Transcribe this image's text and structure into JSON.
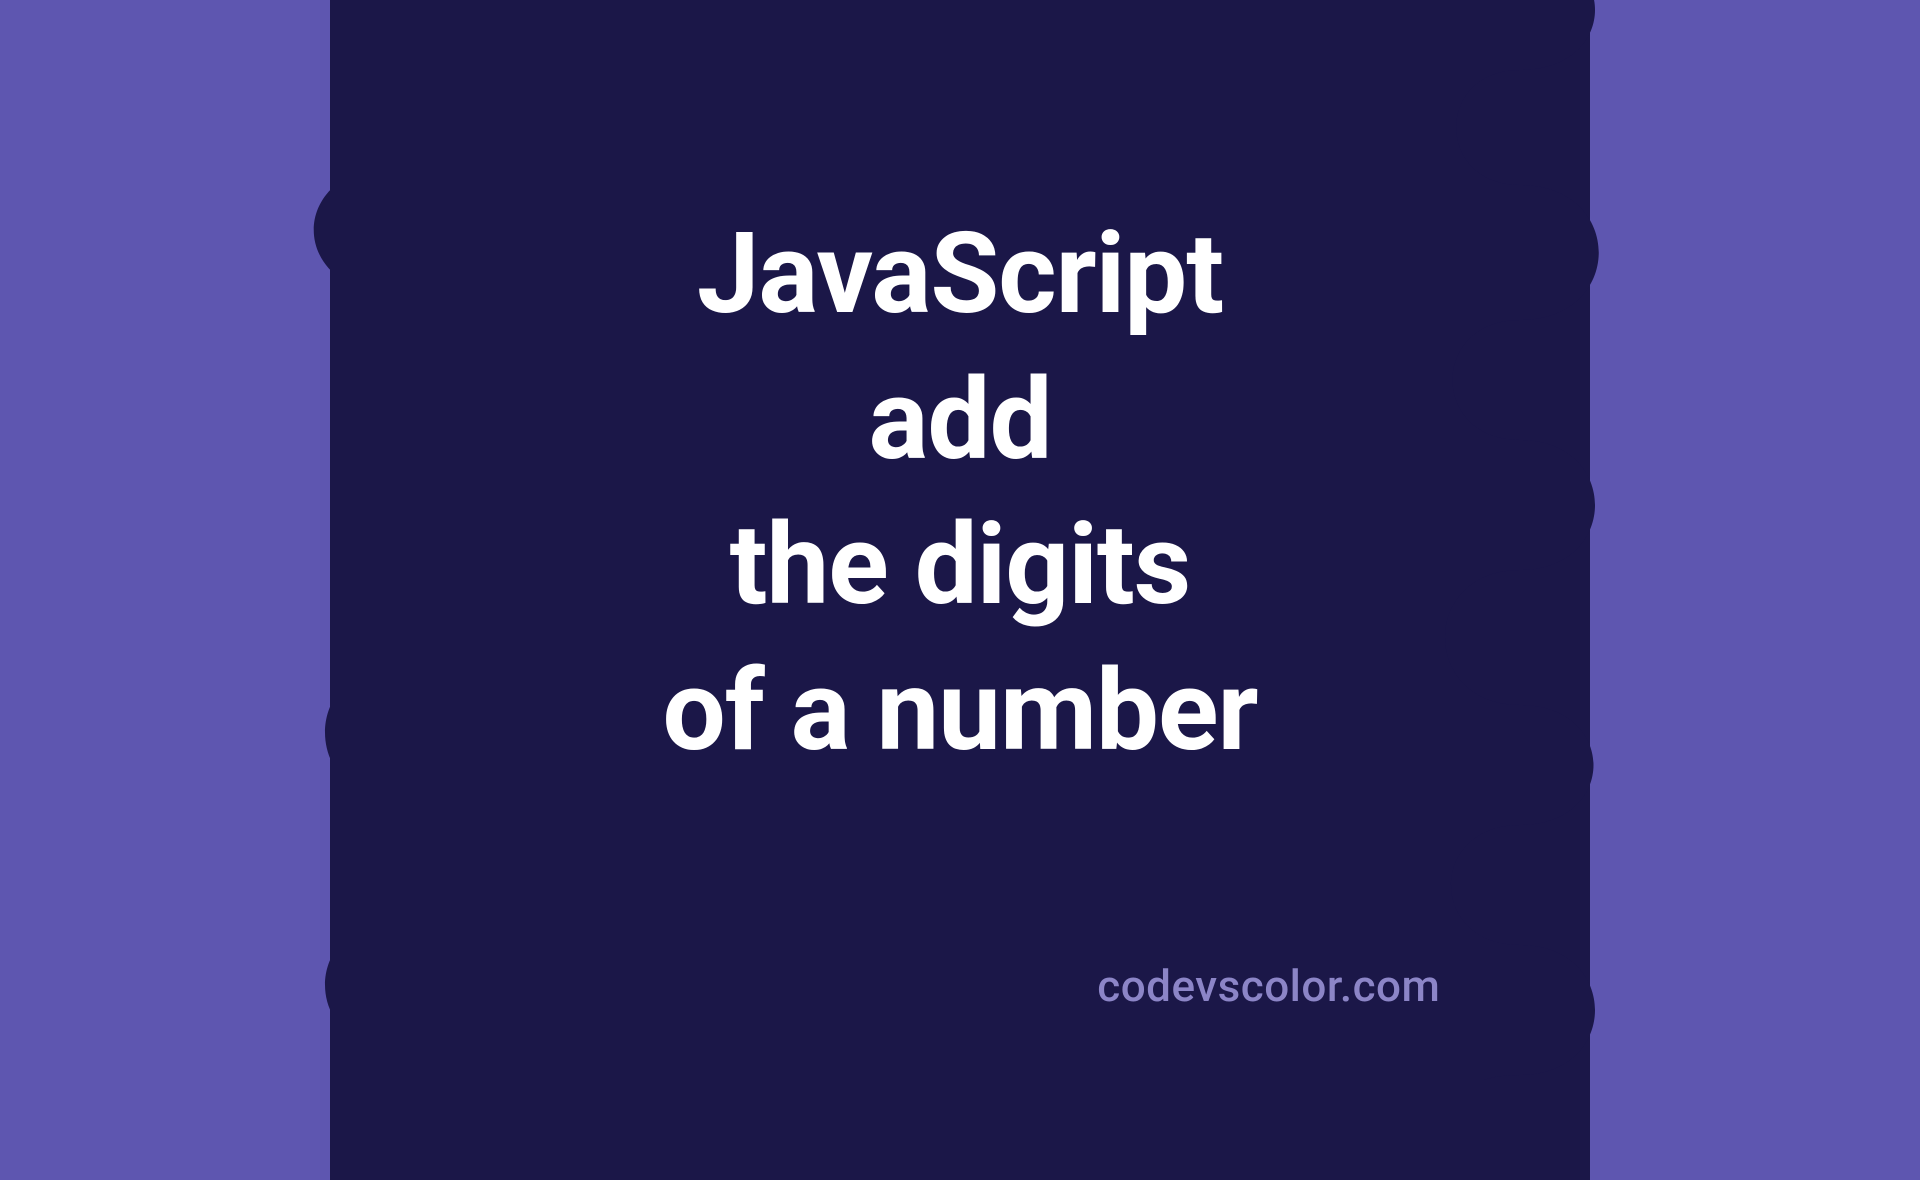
{
  "graphic": {
    "title_lines": "JavaScript\nadd\nthe digits\nof a number",
    "attribution": "codevscolor.com",
    "colors": {
      "background": "#5e56b0",
      "blob": "#1b1748",
      "title": "#ffffff",
      "attribution": "#8c85c7"
    }
  }
}
